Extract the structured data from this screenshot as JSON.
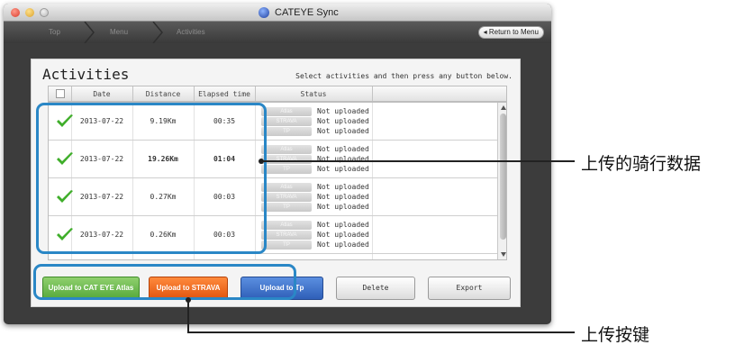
{
  "window": {
    "title": "CATEYE Sync",
    "breadcrumb": [
      "Top",
      "Menu",
      "Activities"
    ],
    "return_button": "◂ Return to Menu"
  },
  "page": {
    "heading": "Activities",
    "instruction": "Select activities and then press any button below."
  },
  "table": {
    "columns": [
      "Date",
      "Distance",
      "Elapsed time",
      "Status"
    ],
    "status_tags": [
      "Atlas",
      "STRAVA",
      "TP"
    ],
    "rows": [
      {
        "date": "2013-07-22",
        "distance": "9.19Km",
        "elapsed": "00:35",
        "status": [
          "Not uploaded",
          "Not uploaded",
          "Not uploaded"
        ]
      },
      {
        "date": "2013-07-22",
        "distance": "19.26Km",
        "elapsed": "01:04",
        "status": [
          "Not uploaded",
          "Not uploaded",
          "Not uploaded"
        ]
      },
      {
        "date": "2013-07-22",
        "distance": "0.27Km",
        "elapsed": "00:03",
        "status": [
          "Not uploaded",
          "Not uploaded",
          "Not uploaded"
        ]
      },
      {
        "date": "2013-07-22",
        "distance": "0.26Km",
        "elapsed": "00:03",
        "status": [
          "Not uploaded",
          "Not uploaded",
          "Not uploaded"
        ]
      }
    ]
  },
  "buttons": {
    "cateye_atlas": "Upload to CAT EYE Atlas",
    "strava": "Upload to STRAVA",
    "tp": "Upload to Tp",
    "delete": "Delete",
    "export": "Export"
  },
  "annotations": {
    "rows_label": "上传的骑行数据",
    "buttons_label": "上传按键"
  },
  "colors": {
    "highlight": "#2a87c6",
    "atlas_green": "#55a83a",
    "strava_orange": "#e0540f",
    "tp_blue": "#2f5fb8"
  }
}
